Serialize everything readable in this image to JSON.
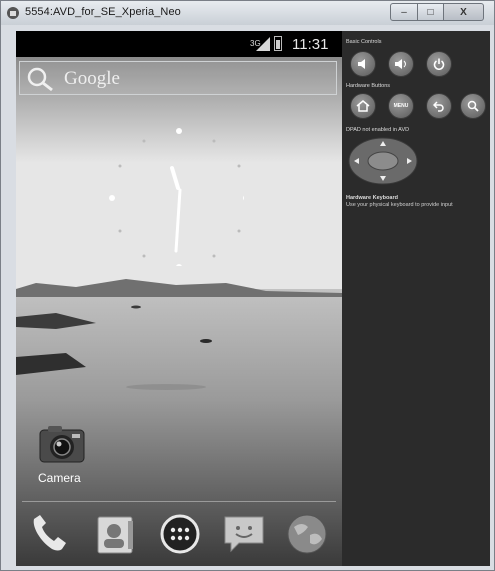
{
  "window": {
    "title": "5554:AVD_for_SE_Xperia_Neo",
    "buttons": {
      "minimize": "–",
      "maximize": "□",
      "close": "X"
    }
  },
  "status_bar": {
    "network": "3G",
    "time": "11:31"
  },
  "search": {
    "label": "Google"
  },
  "homescreen": {
    "camera_label": "Camera"
  },
  "dock": {
    "icons": [
      "phone-icon",
      "contacts-icon",
      "app-drawer-icon",
      "messaging-icon",
      "browser-icon"
    ]
  },
  "controls": {
    "basic_controls_title": "Basic Controls",
    "hardware_buttons_title": "Hardware Buttons",
    "menu_label": "MENU",
    "dpad_title": "DPAD not enabled in AVD",
    "keyboard_title": "Hardware Keyboard",
    "keyboard_desc": "Use your physical keyboard to provide input"
  }
}
